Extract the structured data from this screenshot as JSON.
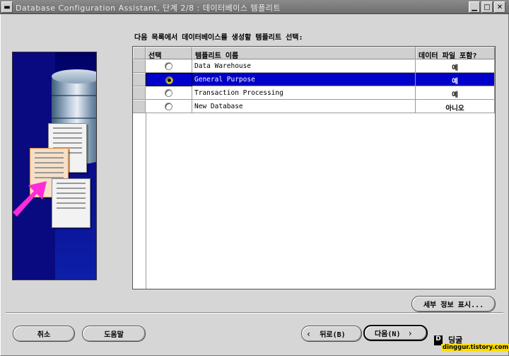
{
  "window": {
    "title": "Database Configuration Assistant, 단계 2/8 : 데이터베이스 템플리트"
  },
  "prompt": "다음 목록에서 데이터베이스를 생성할 템플리트 선택:",
  "table": {
    "columns": [
      "선택",
      "템플리트 이름",
      "데이터 파일 포함?"
    ],
    "rows": [
      {
        "name": "Data Warehouse",
        "includes_data": "예",
        "selected": false
      },
      {
        "name": "General Purpose",
        "includes_data": "예",
        "selected": true
      },
      {
        "name": "Transaction Processing",
        "includes_data": "예",
        "selected": false
      },
      {
        "name": "New Database",
        "includes_data": "아니오",
        "selected": false
      }
    ]
  },
  "buttons": {
    "details": "세부 정보 표시...",
    "cancel": "취소",
    "help": "도움말",
    "back": "뒤로(B)",
    "next": "다음(N)"
  },
  "watermark": {
    "url": "dinggur.tistory.com",
    "name": "딩굴"
  },
  "icons": [
    "close-icon",
    "maximize-icon",
    "minimize-icon",
    "chevron-left-icon",
    "chevron-right-icon",
    "database-icon"
  ]
}
